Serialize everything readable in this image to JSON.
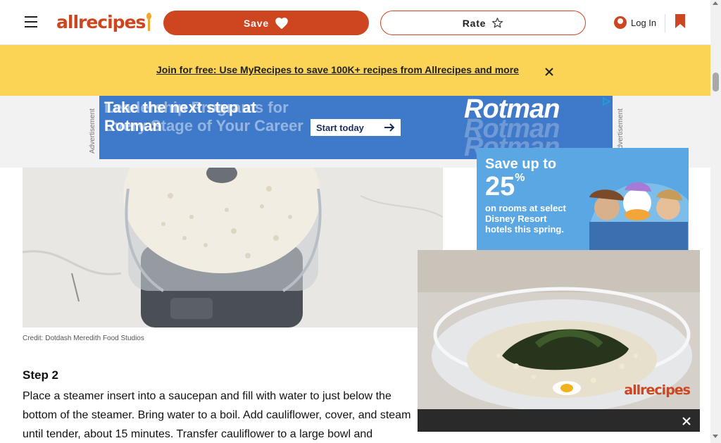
{
  "header": {
    "logo_text": "allrecipes",
    "save_label": "Save",
    "rate_label": "Rate",
    "login_label": "Log In",
    "icons": {
      "menu": "hamburger-menu-icon",
      "save": "heart-icon",
      "rate": "star-outline-icon",
      "login": "user-icon",
      "saved": "bookmark-icon"
    }
  },
  "banner": {
    "link_text": "Join for free: Use MyRecipes to save 100K+ recipes from Allrecipes and more",
    "close_icon": "close-icon"
  },
  "top_ad": {
    "label": "Advertisement",
    "headline_front": "Take the next step at Rotman",
    "headline_back": "Leadership Programs for Every Stage of Your Career",
    "cta": "Start today",
    "brand": "Rotman"
  },
  "article": {
    "photo_credit": "Credit: Dotdash Meredith Food Studios",
    "step_heading": "Step 2",
    "step_text": "Place a steamer insert into a saucepan and fill with water to just below the\nbottom of the steamer. Bring water to a boil. Add cauliflower, cover, and steam\nuntil tender, about 15 minutes. Transfer cauliflower to a large bowl and"
  },
  "side_ad": {
    "line1": "Save up to",
    "amount": "25",
    "percent": "%",
    "body": "on rooms at select Disney Resort hotels this spring."
  },
  "video": {
    "watermark": "allrecipes",
    "close_icon": "close-icon"
  },
  "colors": {
    "brand": "#ce4620",
    "banner": "#fcd455",
    "ad_blue": "#3f79c9"
  }
}
